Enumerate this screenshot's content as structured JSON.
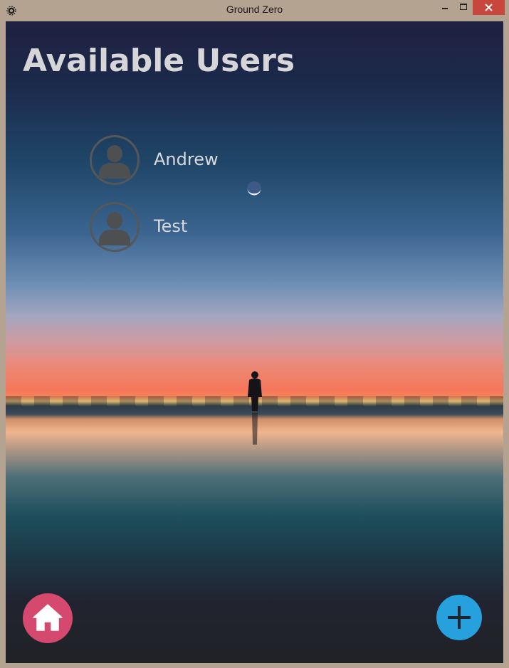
{
  "window": {
    "title": "Ground Zero",
    "chrome_color": "#b4a391",
    "close_color": "#c9463d"
  },
  "page": {
    "title": "Available Users"
  },
  "users": [
    {
      "name": "Andrew",
      "icon": "user-avatar-icon"
    },
    {
      "name": "Test",
      "icon": "user-avatar-icon"
    }
  ],
  "actions": {
    "home": {
      "icon": "home-icon",
      "color": "#d4496d"
    },
    "add": {
      "icon": "plus-icon",
      "color": "#27a0de"
    }
  }
}
